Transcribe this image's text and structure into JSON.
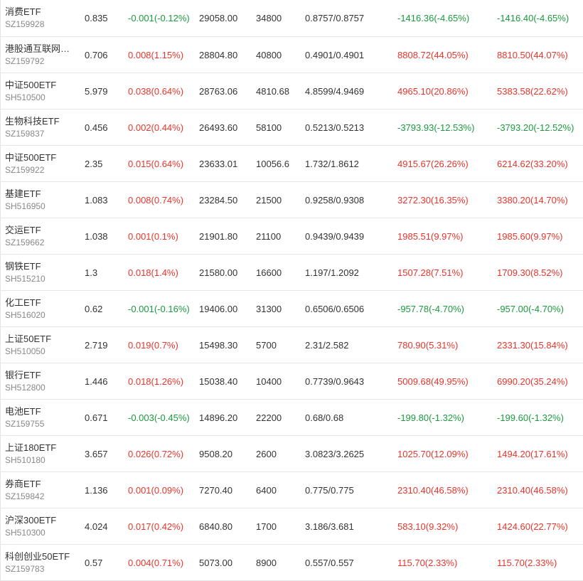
{
  "colors": {
    "up": "#e8352b",
    "down": "#1a9b3d"
  },
  "rows": [
    {
      "name": "消费ETF",
      "code": "SZ159928",
      "price": "0.835",
      "change": "-0.001(-0.12%)",
      "change_dir": "down",
      "amount": "29058.00",
      "volume": "34800",
      "range": "0.8757/0.8757",
      "profit1": "-1416.36(-4.65%)",
      "profit1_dir": "down",
      "profit2": "-1416.40(-4.65%)",
      "profit2_dir": "down"
    },
    {
      "name": "港股通互联网…",
      "code": "SZ159792",
      "price": "0.706",
      "change": "0.008(1.15%)",
      "change_dir": "up",
      "amount": "28804.80",
      "volume": "40800",
      "range": "0.4901/0.4901",
      "profit1": "8808.72(44.05%)",
      "profit1_dir": "up",
      "profit2": "8810.50(44.07%)",
      "profit2_dir": "up"
    },
    {
      "name": "中证500ETF",
      "code": "SH510500",
      "price": "5.979",
      "change": "0.038(0.64%)",
      "change_dir": "up",
      "amount": "28763.06",
      "volume": "4810.68",
      "range": "4.8599/4.9469",
      "profit1": "4965.10(20.86%)",
      "profit1_dir": "up",
      "profit2": "5383.58(22.62%)",
      "profit2_dir": "up"
    },
    {
      "name": "生物科技ETF",
      "code": "SZ159837",
      "price": "0.456",
      "change": "0.002(0.44%)",
      "change_dir": "up",
      "amount": "26493.60",
      "volume": "58100",
      "range": "0.5213/0.5213",
      "profit1": "-3793.93(-12.53%)",
      "profit1_dir": "down",
      "profit2": "-3793.20(-12.52%)",
      "profit2_dir": "down"
    },
    {
      "name": "中证500ETF",
      "code": "SZ159922",
      "price": "2.35",
      "change": "0.015(0.64%)",
      "change_dir": "up",
      "amount": "23633.01",
      "volume": "10056.6",
      "range": "1.732/1.8612",
      "profit1": "4915.67(26.26%)",
      "profit1_dir": "up",
      "profit2": "6214.62(33.20%)",
      "profit2_dir": "up"
    },
    {
      "name": "基建ETF",
      "code": "SH516950",
      "price": "1.083",
      "change": "0.008(0.74%)",
      "change_dir": "up",
      "amount": "23284.50",
      "volume": "21500",
      "range": "0.9258/0.9308",
      "profit1": "3272.30(16.35%)",
      "profit1_dir": "up",
      "profit2": "3380.20(14.70%)",
      "profit2_dir": "up"
    },
    {
      "name": "交运ETF",
      "code": "SZ159662",
      "price": "1.038",
      "change": "0.001(0.1%)",
      "change_dir": "up",
      "amount": "21901.80",
      "volume": "21100",
      "range": "0.9439/0.9439",
      "profit1": "1985.51(9.97%)",
      "profit1_dir": "up",
      "profit2": "1985.60(9.97%)",
      "profit2_dir": "up"
    },
    {
      "name": "钢铁ETF",
      "code": "SH515210",
      "price": "1.3",
      "change": "0.018(1.4%)",
      "change_dir": "up",
      "amount": "21580.00",
      "volume": "16600",
      "range": "1.197/1.2092",
      "profit1": "1507.28(7.51%)",
      "profit1_dir": "up",
      "profit2": "1709.30(8.52%)",
      "profit2_dir": "up"
    },
    {
      "name": "化工ETF",
      "code": "SH516020",
      "price": "0.62",
      "change": "-0.001(-0.16%)",
      "change_dir": "down",
      "amount": "19406.00",
      "volume": "31300",
      "range": "0.6506/0.6506",
      "profit1": "-957.78(-4.70%)",
      "profit1_dir": "down",
      "profit2": "-957.00(-4.70%)",
      "profit2_dir": "down"
    },
    {
      "name": "上证50ETF",
      "code": "SH510050",
      "price": "2.719",
      "change": "0.019(0.7%)",
      "change_dir": "up",
      "amount": "15498.30",
      "volume": "5700",
      "range": "2.31/2.582",
      "profit1": "780.90(5.31%)",
      "profit1_dir": "up",
      "profit2": "2331.30(15.84%)",
      "profit2_dir": "up"
    },
    {
      "name": "银行ETF",
      "code": "SH512800",
      "price": "1.446",
      "change": "0.018(1.26%)",
      "change_dir": "up",
      "amount": "15038.40",
      "volume": "10400",
      "range": "0.7739/0.9643",
      "profit1": "5009.68(49.95%)",
      "profit1_dir": "up",
      "profit2": "6990.20(35.24%)",
      "profit2_dir": "up"
    },
    {
      "name": "电池ETF",
      "code": "SZ159755",
      "price": "0.671",
      "change": "-0.003(-0.45%)",
      "change_dir": "down",
      "amount": "14896.20",
      "volume": "22200",
      "range": "0.68/0.68",
      "profit1": "-199.80(-1.32%)",
      "profit1_dir": "down",
      "profit2": "-199.60(-1.32%)",
      "profit2_dir": "down"
    },
    {
      "name": "上证180ETF",
      "code": "SH510180",
      "price": "3.657",
      "change": "0.026(0.72%)",
      "change_dir": "up",
      "amount": "9508.20",
      "volume": "2600",
      "range": "3.0823/3.2625",
      "profit1": "1025.70(12.09%)",
      "profit1_dir": "up",
      "profit2": "1494.20(17.61%)",
      "profit2_dir": "up"
    },
    {
      "name": "券商ETF",
      "code": "SZ159842",
      "price": "1.136",
      "change": "0.001(0.09%)",
      "change_dir": "up",
      "amount": "7270.40",
      "volume": "6400",
      "range": "0.775/0.775",
      "profit1": "2310.40(46.58%)",
      "profit1_dir": "up",
      "profit2": "2310.40(46.58%)",
      "profit2_dir": "up"
    },
    {
      "name": "沪深300ETF",
      "code": "SH510300",
      "price": "4.024",
      "change": "0.017(0.42%)",
      "change_dir": "up",
      "amount": "6840.80",
      "volume": "1700",
      "range": "3.186/3.681",
      "profit1": "583.10(9.32%)",
      "profit1_dir": "up",
      "profit2": "1424.60(22.77%)",
      "profit2_dir": "up"
    },
    {
      "name": "科创创业50ETF",
      "code": "SZ159783",
      "price": "0.57",
      "change": "0.004(0.71%)",
      "change_dir": "up",
      "amount": "5073.00",
      "volume": "8900",
      "range": "0.557/0.557",
      "profit1": "115.70(2.33%)",
      "profit1_dir": "up",
      "profit2": "115.70(2.33%)",
      "profit2_dir": "up"
    }
  ]
}
